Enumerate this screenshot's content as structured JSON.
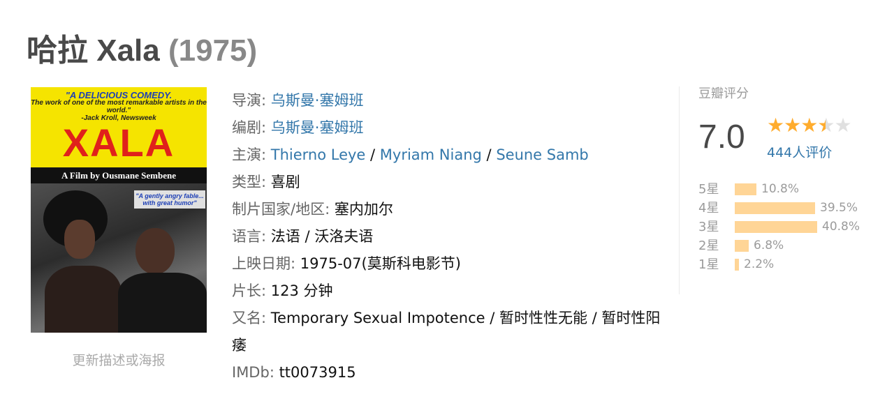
{
  "movie": {
    "title": "哈拉 Xala",
    "year": "(1975)"
  },
  "poster": {
    "tagline_1": "\"A DELICIOUS COMEDY.",
    "tagline_2": "The work of one of the most remarkable artists in the world.\"",
    "tagline_3": "-Jack Kroll, Newsweek",
    "logo": "XALA",
    "band": "A Film by Ousmane Sembene",
    "quote": "\"A gently angry fable... with great humor\"",
    "edit_link": "更新描述或海报"
  },
  "info": {
    "director": {
      "label": "导演",
      "value": "乌斯曼·塞姆班"
    },
    "writer": {
      "label": "编剧",
      "value": "乌斯曼·塞姆班"
    },
    "cast": {
      "label": "主演",
      "names": [
        "Thierno Leye",
        "Myriam Niang",
        "Seune Samb"
      ],
      "sep": " / "
    },
    "genre": {
      "label": "类型",
      "value": "喜剧"
    },
    "country": {
      "label": "制片国家/地区",
      "value": "塞内加尔"
    },
    "language": {
      "label": "语言",
      "value": "法语 / 沃洛夫语"
    },
    "release": {
      "label": "上映日期",
      "value": "1975-07(莫斯科电影节)"
    },
    "runtime": {
      "label": "片长",
      "value": "123 分钟"
    },
    "aka": {
      "label": "又名",
      "value": "Temporary Sexual Impotence / 暂时性性无能 / 暂时性阳痿"
    },
    "imdb": {
      "label": "IMDb",
      "value": "tt0073915"
    }
  },
  "rating": {
    "label": "豆瓣评分",
    "score": "7.0",
    "stars_value": 3.5,
    "votes": "444人评价",
    "breakdown": [
      {
        "label": "5星",
        "pct": "10.8%",
        "value": 10.8
      },
      {
        "label": "4星",
        "pct": "39.5%",
        "value": 39.5
      },
      {
        "label": "3星",
        "pct": "40.8%",
        "value": 40.8
      },
      {
        "label": "2星",
        "pct": "6.8%",
        "value": 6.8
      },
      {
        "label": "1星",
        "pct": "2.2%",
        "value": 2.2
      }
    ],
    "colors": {
      "star": "#ffac2d",
      "bar": "#ffd596",
      "link": "#3377aa"
    }
  }
}
